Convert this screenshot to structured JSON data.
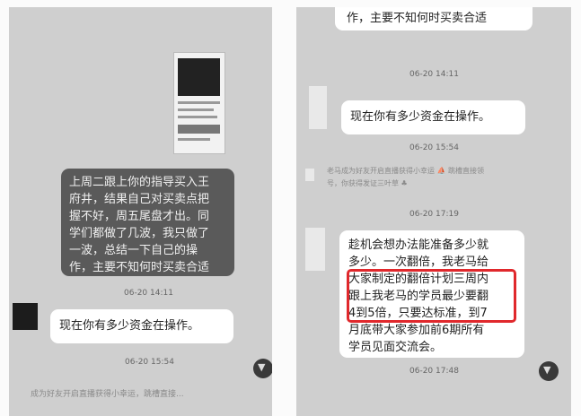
{
  "left_chat": {
    "dark_message": "上周二跟上你的指导买入王\n府井，结果自己对买卖点把\n握不好，周五尾盘才出。同\n学们都做了几波，我只做了\n一波，总结一下自己的操\n作，主要不知何时买卖合适",
    "timestamp_1": "06-20 14:11",
    "reply_message": "现在你有多少资金在操作。",
    "timestamp_2": "06-20 15:54",
    "cut_message": "成为好友开启直播获得小幸运，跳槽直接..."
  },
  "right_chat": {
    "top_message": "作，主要不知何时买卖合适",
    "timestamp_1": "06-20 14:11",
    "question_message": "现在你有多少资金在操作。",
    "timestamp_2": "06-20 15:54",
    "notice_message": "老马成为好友开启直播获得小幸运 ⛵  跳槽直接领\n号，你获得发证三叶草 ♣",
    "timestamp_3": "06-20 17:19",
    "long_message": "趁机会想办法能准备多少就\n多少。一次翻倍，我老马给\n大家制定的翻倍计划三周内\n跟上我老马的学员最少要翻\n4到5倍，只要达标准，到7\n月底带大家参加前6期所有\n学员见面交流会。",
    "timestamp_4": "06-20 17:48"
  },
  "icons": {
    "scroll": "chevron-down-icon"
  }
}
